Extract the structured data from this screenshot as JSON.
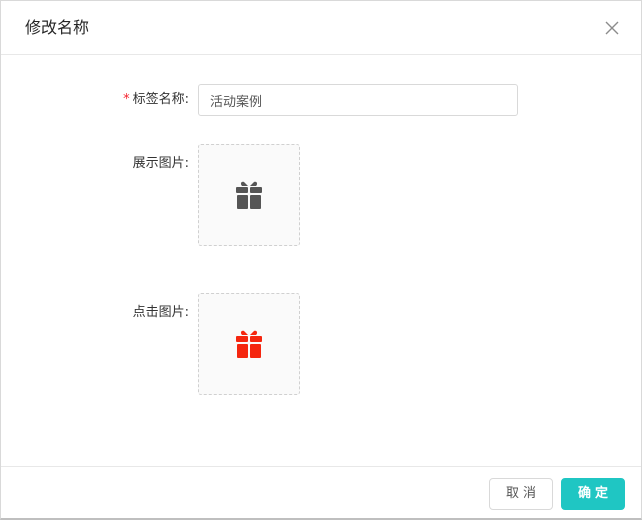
{
  "modal": {
    "title": "修改名称"
  },
  "form": {
    "tag_name": {
      "required_mark": "*",
      "label": "标签名称:",
      "value": "活动案例"
    },
    "display_image": {
      "label": "展示图片:",
      "icon": "gift-icon",
      "icon_color": "#555555"
    },
    "click_image": {
      "label": "点击图片:",
      "icon": "gift-icon",
      "icon_color": "#f5260f"
    }
  },
  "footer": {
    "cancel_label": "取消",
    "ok_label": "确定",
    "accent_color": "#1fc6c3"
  }
}
